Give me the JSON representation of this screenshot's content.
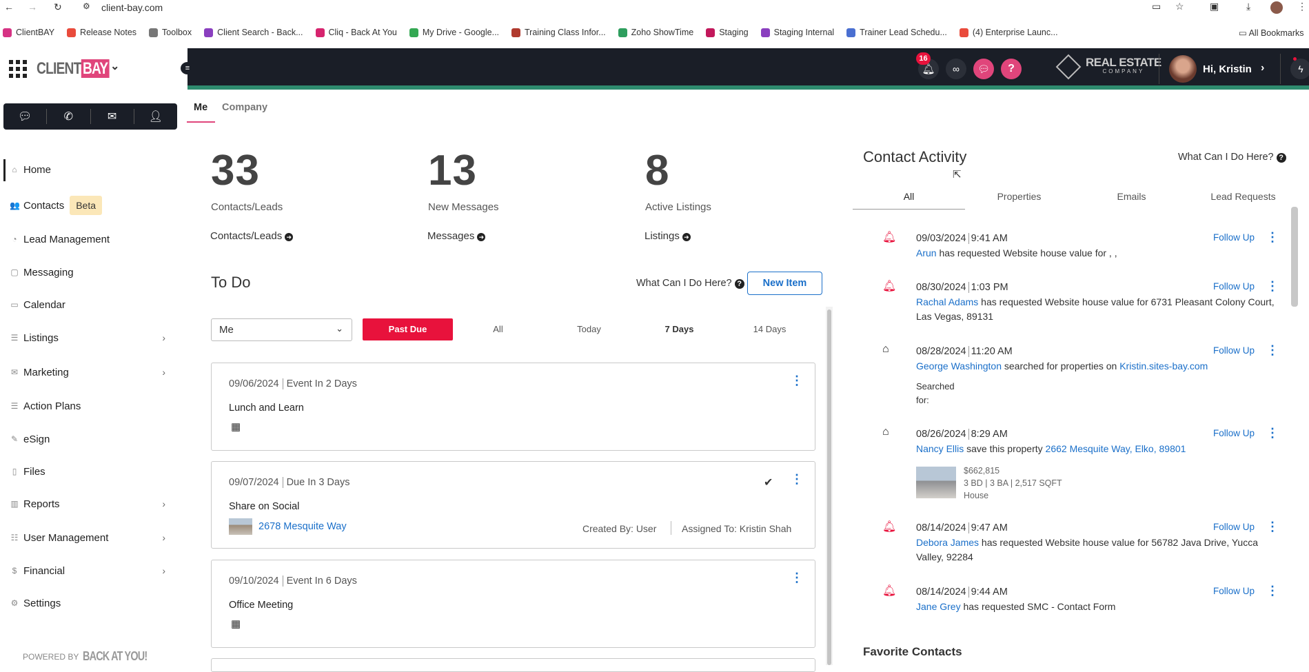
{
  "browser": {
    "url": "client-bay.com"
  },
  "bookmarks": [
    {
      "label": "ClientBAY",
      "color": "#d63384"
    },
    {
      "label": "Release Notes",
      "color": "#e94b3c"
    },
    {
      "label": "Toolbox",
      "color": "#777"
    },
    {
      "label": "Client Search - Back...",
      "color": "#8a3fbf"
    },
    {
      "label": "Cliq - Back At You",
      "color": "#d6246e"
    },
    {
      "label": "My Drive - Google...",
      "color": "#34a853"
    },
    {
      "label": "Training Class Infor...",
      "color": "#b03a2e"
    },
    {
      "label": "Zoho ShowTime",
      "color": "#2e9e5e"
    },
    {
      "label": "Staging",
      "color": "#c2185b"
    },
    {
      "label": "Staging Internal",
      "color": "#8a3fbf"
    },
    {
      "label": "Trainer Lead Schedu...",
      "color": "#4a6fd1"
    },
    {
      "label": "(4) Enterprise Launc...",
      "color": "#e94b3c"
    }
  ],
  "all_bookmarks": "All Bookmarks",
  "brand": {
    "client": "CLIENT",
    "bay": "BAY",
    "realestate": "REAL ESTATE",
    "company": "COMPANY",
    "powered": "POWERED BY",
    "bay_logo": "BACK AT YOU!"
  },
  "header": {
    "notif_count": "16",
    "greeting": "Hi, Kristin"
  },
  "nav": [
    {
      "label": "Home",
      "icon": "⌂"
    },
    {
      "label": "Contacts",
      "icon": "👥",
      "badge": "Beta"
    },
    {
      "label": "Lead Management",
      "icon": "◔"
    },
    {
      "label": "Messaging",
      "icon": "▢"
    },
    {
      "label": "Calendar",
      "icon": "▭"
    },
    {
      "label": "Listings",
      "icon": "☰"
    },
    {
      "label": "Marketing",
      "icon": "✉"
    },
    {
      "label": "Action Plans",
      "icon": "☰"
    },
    {
      "label": "eSign",
      "icon": "✎"
    },
    {
      "label": "Files",
      "icon": "▯"
    },
    {
      "label": "Reports",
      "icon": "▥"
    },
    {
      "label": "User Management",
      "icon": "☷"
    },
    {
      "label": "Financial",
      "icon": "$"
    },
    {
      "label": "Settings",
      "icon": "⚙"
    }
  ],
  "tabs": {
    "me": "Me",
    "company": "Company"
  },
  "stats": [
    {
      "num": "33",
      "label": "Contacts/Leads",
      "link": "Contacts/Leads"
    },
    {
      "num": "13",
      "label": "New Messages",
      "link": "Messages"
    },
    {
      "num": "8",
      "label": "Active Listings",
      "link": "Listings"
    }
  ],
  "todo": {
    "title": "To Do",
    "help": "What Can I Do Here?",
    "new_item": "New Item",
    "select": "Me",
    "filters": [
      "Past Due",
      "All",
      "Today",
      "7 Days",
      "14 Days"
    ],
    "cards": [
      {
        "date": "09/06/2024",
        "status": "Event In 2 Days",
        "title": "Lunch and Learn"
      },
      {
        "date": "09/07/2024",
        "status": "Due In 3 Days",
        "title": "Share on Social",
        "link": "2678 Mesquite Way",
        "created": "Created By: User",
        "assigned": "Assigned To: Kristin Shah"
      },
      {
        "date": "09/10/2024",
        "status": "Event In 6 Days",
        "title": "Office Meeting"
      }
    ]
  },
  "activity": {
    "title": "Contact Activity",
    "help": "What Can I Do Here?",
    "tabs": [
      "All",
      "Properties",
      "Emails",
      "Lead Requests"
    ],
    "follow": "Follow Up",
    "items": [
      {
        "date": "09/03/2024",
        "time": "9:41 AM",
        "name": "Arun",
        "text": " has requested Website house value for , ,"
      },
      {
        "date": "08/30/2024",
        "time": "1:03 PM",
        "name": "Rachal Adams",
        "text": " has requested Website house value for 6731 Pleasant Colony Court, Las Vegas, 89131"
      },
      {
        "date": "08/28/2024",
        "time": "11:20 AM",
        "name": "George Washington",
        "text": " searched for properties on ",
        "link": "Kristin.sites-bay.com",
        "extra1": "Searched",
        "extra2": "for:"
      },
      {
        "date": "08/26/2024",
        "time": "8:29 AM",
        "name": "Nancy Ellis",
        "text": " save this property ",
        "link": "2662 Mesquite Way, Elko, 89801",
        "price": "$662,815",
        "specs": "3 BD | 3 BA | 2,517 SQFT",
        "ptype": "House"
      },
      {
        "date": "08/14/2024",
        "time": "9:47 AM",
        "name": "Debora James",
        "text": " has requested Website house value for 56782 Java Drive, Yucca Valley, 92284"
      },
      {
        "date": "08/14/2024",
        "time": "9:44 AM",
        "name": "Jane Grey",
        "text": " has requested SMC - Contact Form"
      }
    ],
    "favorites": "Favorite Contacts"
  },
  "colors": {
    "accent": "#e0457b",
    "nav_dark": "#1a1e27",
    "teal": "#2e8b6e",
    "red": "#e8123c",
    "link": "#1a6fc9"
  }
}
